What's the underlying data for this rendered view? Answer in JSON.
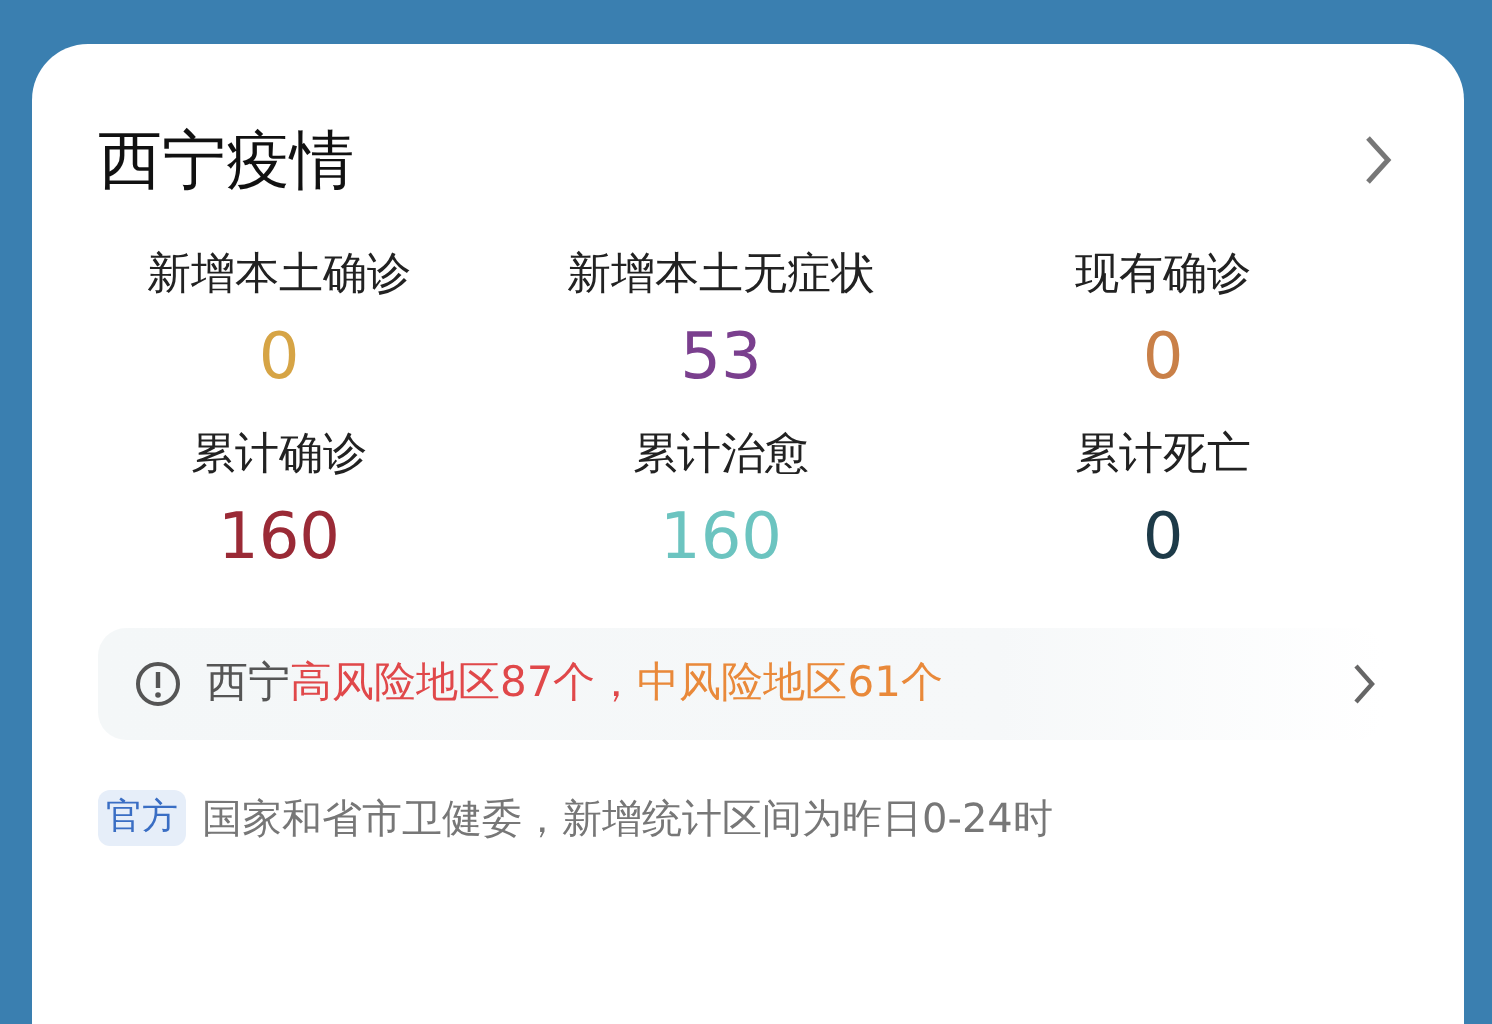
{
  "card": {
    "title": "西宁疫情",
    "stats": [
      {
        "label": "新增本土确诊",
        "value": "0",
        "color": "#d6a445"
      },
      {
        "label": "新增本土无症状",
        "value": "53",
        "color": "#7a3f8e"
      },
      {
        "label": "现有确诊",
        "value": "0",
        "color": "#c98048"
      },
      {
        "label": "累计确诊",
        "value": "160",
        "color": "#9a2a36"
      },
      {
        "label": "累计治愈",
        "value": "160",
        "color": "#6cc4c0"
      },
      {
        "label": "累计死亡",
        "value": "0",
        "color": "#1d3a48"
      }
    ],
    "notice": {
      "segments": [
        {
          "text": "西宁",
          "color": "#555555"
        },
        {
          "text": "高风险地区87个，",
          "color": "#e0484a"
        },
        {
          "text": "中风险地区61个",
          "color": "#e9893a"
        }
      ]
    },
    "source": {
      "badge": "官方",
      "text": "国家和省市卫健委，新增统计区间为昨日0-24时"
    }
  }
}
